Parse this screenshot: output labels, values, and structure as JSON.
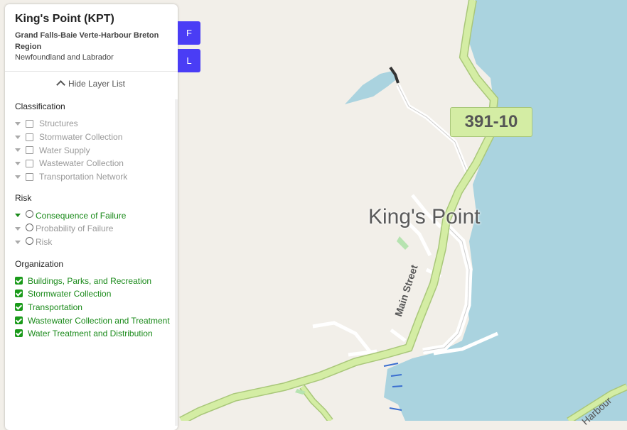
{
  "header": {
    "title": "King's Point (KPT)",
    "region": "Grand Falls-Baie Verte-Harbour Breton Region",
    "province": "Newfoundland and Labrador"
  },
  "layer_toggle": {
    "label": "Hide Layer List",
    "icon": "chevron-up-icon"
  },
  "classification": {
    "title": "Classification",
    "items": [
      "Structures",
      "Stormwater Collection",
      "Water Supply",
      "Wastewater Collection",
      "Transportation Network"
    ]
  },
  "risk": {
    "title": "Risk",
    "items": [
      {
        "label": "Consequence of Failure",
        "selected": true
      },
      {
        "label": "Probability of Failure",
        "selected": false
      },
      {
        "label": "Risk",
        "selected": false
      }
    ]
  },
  "organization": {
    "title": "Organization",
    "items": [
      "Buildings, Parks, and Recreation",
      "Stormwater Collection",
      "Transportation",
      "Wastewater Collection and Treatment",
      "Water Treatment and Distribution"
    ]
  },
  "side_buttons": {
    "first": "F",
    "second": "L"
  },
  "map": {
    "route_shield": "391-10",
    "town": "King's Point",
    "street": "Main Street",
    "harbour_fragment": "Harbour",
    "colors": {
      "water": "#aad3df",
      "land": "#f2efe9",
      "road": "#d4eda4",
      "accent": "#1a8a1a",
      "button": "#4a3df5"
    }
  }
}
